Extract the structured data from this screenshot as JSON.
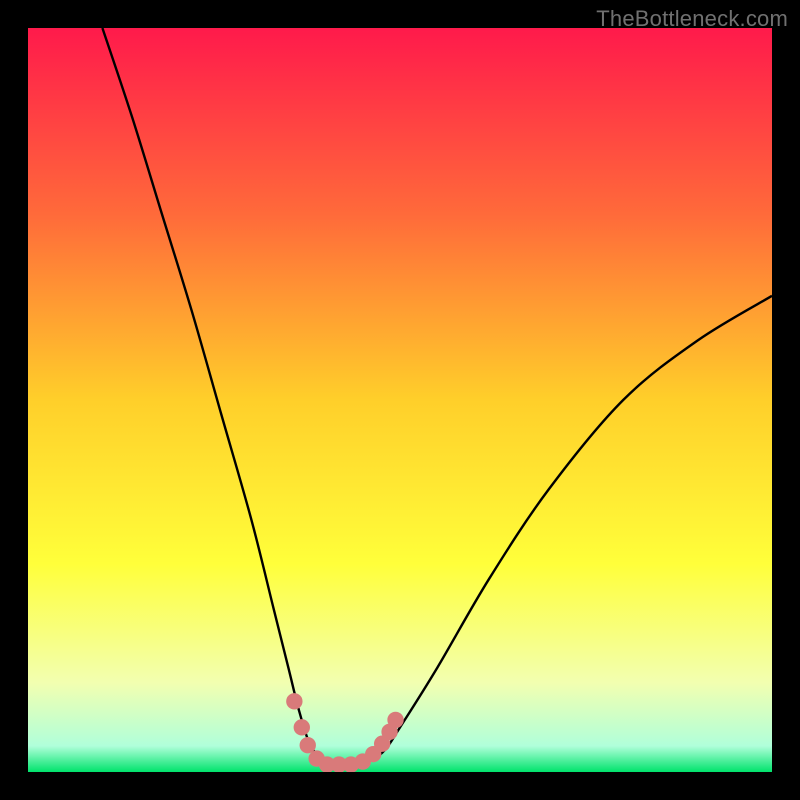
{
  "watermark": {
    "text": "TheBottleneck.com"
  },
  "chart_data": {
    "type": "line",
    "title": "",
    "xlabel": "",
    "ylabel": "",
    "xlim": [
      0,
      100
    ],
    "ylim": [
      0,
      100
    ],
    "grid": false,
    "legend": false,
    "background_gradient": {
      "stops": [
        {
          "pos": 0.0,
          "color": "#ff1a4b"
        },
        {
          "pos": 0.25,
          "color": "#ff6a3a"
        },
        {
          "pos": 0.5,
          "color": "#ffcf2a"
        },
        {
          "pos": 0.72,
          "color": "#ffff3a"
        },
        {
          "pos": 0.88,
          "color": "#f2ffb0"
        },
        {
          "pos": 0.965,
          "color": "#b0ffda"
        },
        {
          "pos": 1.0,
          "color": "#00e36c"
        }
      ]
    },
    "series": [
      {
        "name": "bottleneck-curve",
        "color": "#000000",
        "x": [
          10,
          14,
          18,
          22,
          26,
          30,
          33,
          35,
          36.5,
          38,
          40,
          42,
          44,
          46,
          48,
          50,
          55,
          62,
          70,
          80,
          90,
          100
        ],
        "y": [
          100,
          88,
          75,
          62,
          48,
          34,
          22,
          14,
          8,
          3.5,
          1.5,
          1,
          1,
          1.5,
          3,
          6,
          14,
          26,
          38,
          50,
          58,
          64
        ]
      }
    ],
    "markers": {
      "name": "valley-markers",
      "color": "#d97a7a",
      "radius_pct": 1.1,
      "points": [
        {
          "x": 35.8,
          "y": 9.5
        },
        {
          "x": 36.8,
          "y": 6.0
        },
        {
          "x": 37.6,
          "y": 3.6
        },
        {
          "x": 38.8,
          "y": 1.8
        },
        {
          "x": 40.2,
          "y": 1.0
        },
        {
          "x": 41.8,
          "y": 1.0
        },
        {
          "x": 43.4,
          "y": 1.0
        },
        {
          "x": 45.0,
          "y": 1.4
        },
        {
          "x": 46.4,
          "y": 2.4
        },
        {
          "x": 47.6,
          "y": 3.8
        },
        {
          "x": 48.6,
          "y": 5.4
        },
        {
          "x": 49.4,
          "y": 7.0
        }
      ]
    }
  }
}
